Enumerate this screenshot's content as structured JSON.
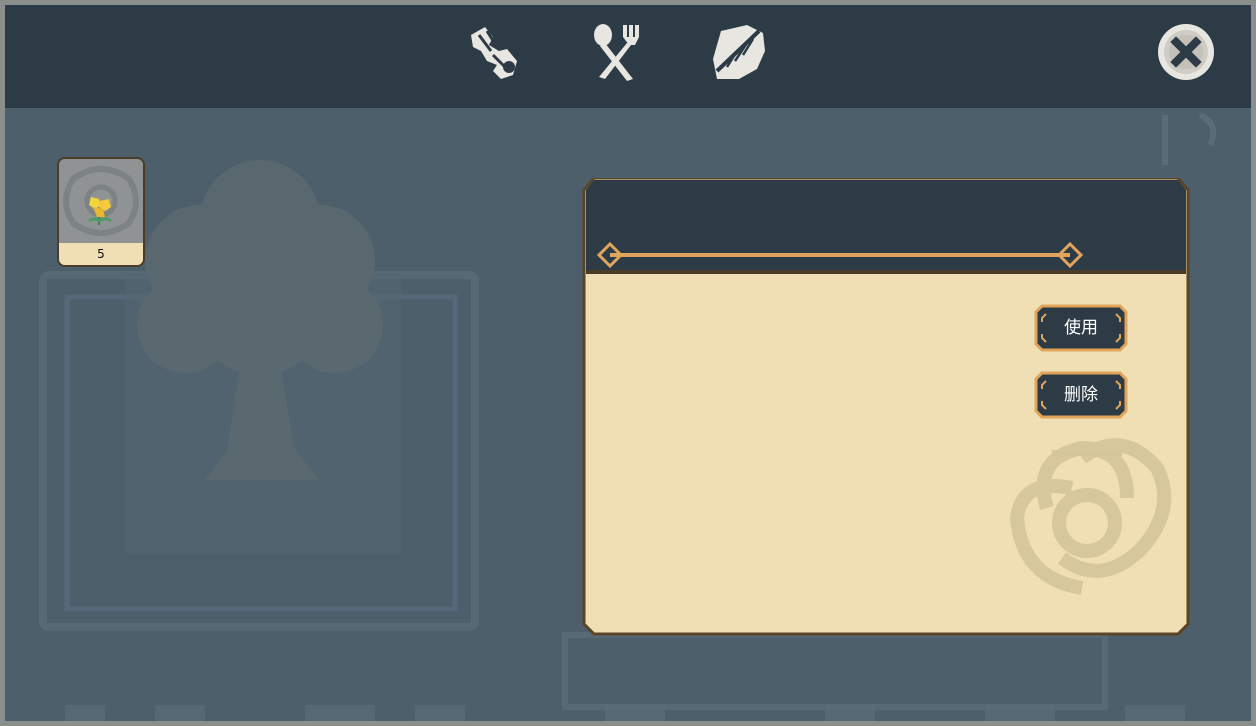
{
  "tabs": [
    {
      "icon": "herb-leaf-icon"
    },
    {
      "icon": "fork-spoon-icon"
    },
    {
      "icon": "feather-quill-icon"
    }
  ],
  "close": {
    "icon": "close-icon"
  },
  "inventory": {
    "items": [
      {
        "icon": "yellow-flower-icon",
        "count": "5"
      }
    ]
  },
  "detail": {
    "actions": {
      "use_label": "使用",
      "delete_label": "删除"
    }
  },
  "colors": {
    "topbar": "#2d3b47",
    "background": "#4c5f6b",
    "panel_header": "#2d3b47",
    "panel_body": "#f0dfb4",
    "gold": "#e0a55a",
    "border_brown": "#4a3c26"
  }
}
